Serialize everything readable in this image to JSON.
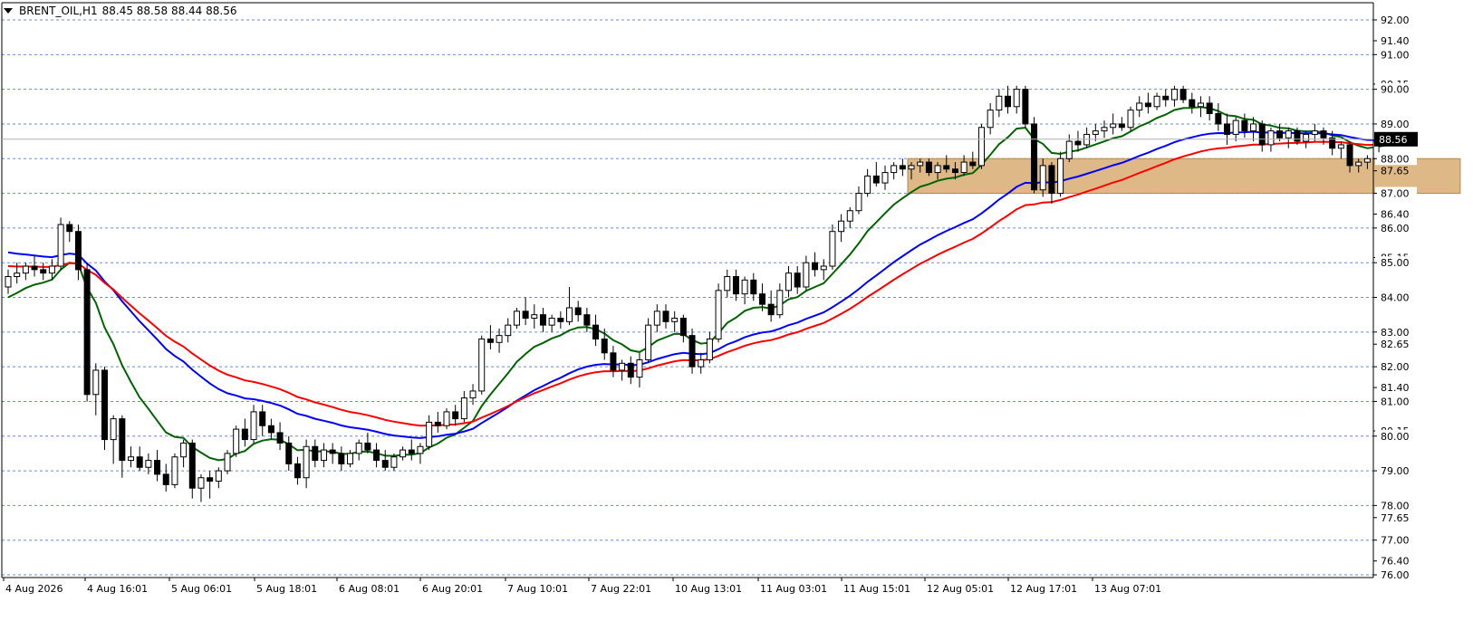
{
  "header": {
    "symbol_timeframe": "BRENT_OIL,H1",
    "ohlc": "88.45 88.58 88.44 88.56"
  },
  "chart_data": {
    "type": "candlestick",
    "ylim": [
      76.0,
      92.1
    ],
    "grid": true,
    "price_grid_levels": [
      92.0,
      91.0,
      90.0,
      89.0,
      88.0,
      87.0,
      86.0,
      85.0,
      84.0,
      83.0,
      82.0,
      81.0,
      80.0,
      79.0,
      78.0,
      77.0,
      76.0
    ],
    "y_tick_labels": [
      "92.00",
      "91.40",
      "91.00",
      "90.15",
      "90.00",
      "89.00",
      "88.00",
      "87.65",
      "87.00",
      "86.40",
      "86.00",
      "85.15",
      "85.00",
      "84.00",
      "83.00",
      "82.65",
      "82.00",
      "81.40",
      "81.00",
      "80.15",
      "80.00",
      "79.00",
      "78.00",
      "77.65",
      "77.00",
      "76.40",
      "76.00"
    ],
    "current_price": 88.56,
    "x_tick_labels": [
      "4 Aug 2026",
      "4 Aug 16:01",
      "5 Aug 06:01",
      "5 Aug 18:01",
      "6 Aug 08:01",
      "6 Aug 20:01",
      "7 Aug 10:01",
      "7 Aug 22:01",
      "10 Aug 13:01",
      "11 Aug 03:01",
      "11 Aug 15:01",
      "12 Aug 05:01",
      "12 Aug 17:01",
      "13 Aug 07:01"
    ],
    "zone": {
      "low": 87.0,
      "high": 88.0,
      "from_bar": 103,
      "to_bar": 166,
      "color": "#deb887"
    },
    "candles": [
      [
        84.3,
        84.8,
        84.1,
        84.6
      ],
      [
        84.6,
        85.0,
        84.4,
        84.7
      ],
      [
        84.7,
        85.0,
        84.5,
        84.9
      ],
      [
        84.9,
        85.2,
        84.6,
        84.8
      ],
      [
        84.8,
        85.0,
        84.5,
        84.7
      ],
      [
        84.7,
        85.1,
        84.5,
        84.9
      ],
      [
        84.9,
        86.3,
        84.8,
        86.1
      ],
      [
        86.1,
        86.2,
        85.6,
        85.9
      ],
      [
        85.9,
        86.1,
        84.5,
        84.8
      ],
      [
        84.8,
        85.0,
        81.0,
        81.2
      ],
      [
        81.2,
        82.1,
        80.6,
        81.9
      ],
      [
        81.9,
        82.0,
        79.6,
        79.9
      ],
      [
        79.9,
        80.6,
        79.2,
        80.5
      ],
      [
        80.5,
        80.6,
        78.8,
        79.3
      ],
      [
        79.3,
        79.7,
        79.1,
        79.4
      ],
      [
        79.4,
        79.7,
        79.0,
        79.1
      ],
      [
        79.1,
        79.5,
        78.9,
        79.3
      ],
      [
        79.3,
        79.6,
        78.7,
        78.9
      ],
      [
        78.9,
        79.2,
        78.4,
        78.6
      ],
      [
        78.6,
        79.5,
        78.5,
        79.4
      ],
      [
        79.4,
        79.9,
        79.1,
        79.8
      ],
      [
        79.8,
        79.9,
        78.2,
        78.5
      ],
      [
        78.5,
        78.9,
        78.1,
        78.8
      ],
      [
        78.8,
        79.0,
        78.2,
        78.7
      ],
      [
        78.7,
        79.1,
        78.5,
        79.0
      ],
      [
        79.0,
        79.6,
        78.9,
        79.5
      ],
      [
        79.5,
        80.3,
        79.4,
        80.2
      ],
      [
        80.2,
        80.5,
        79.7,
        79.9
      ],
      [
        79.9,
        80.9,
        79.8,
        80.7
      ],
      [
        80.7,
        80.9,
        80.0,
        80.3
      ],
      [
        80.3,
        80.5,
        79.9,
        80.1
      ],
      [
        80.1,
        80.4,
        79.6,
        79.8
      ],
      [
        79.8,
        80.0,
        79.0,
        79.2
      ],
      [
        79.2,
        79.4,
        78.6,
        78.8
      ],
      [
        78.8,
        79.9,
        78.5,
        79.7
      ],
      [
        79.7,
        79.9,
        79.1,
        79.3
      ],
      [
        79.3,
        79.8,
        79.1,
        79.6
      ],
      [
        79.6,
        79.8,
        79.2,
        79.5
      ],
      [
        79.5,
        79.7,
        79.0,
        79.2
      ],
      [
        79.2,
        79.6,
        79.1,
        79.5
      ],
      [
        79.5,
        79.9,
        79.3,
        79.8
      ],
      [
        79.8,
        80.1,
        79.5,
        79.6
      ],
      [
        79.6,
        79.8,
        79.1,
        79.3
      ],
      [
        79.3,
        79.6,
        79.0,
        79.1
      ],
      [
        79.1,
        79.5,
        79.0,
        79.4
      ],
      [
        79.4,
        79.7,
        79.3,
        79.6
      ],
      [
        79.6,
        79.9,
        79.3,
        79.5
      ],
      [
        79.5,
        79.8,
        79.2,
        79.7
      ],
      [
        79.7,
        80.6,
        79.6,
        80.4
      ],
      [
        80.4,
        80.7,
        80.1,
        80.3
      ],
      [
        80.3,
        80.8,
        80.2,
        80.7
      ],
      [
        80.7,
        80.9,
        80.3,
        80.5
      ],
      [
        80.5,
        81.3,
        80.4,
        81.1
      ],
      [
        81.1,
        81.5,
        80.9,
        81.3
      ],
      [
        81.3,
        82.9,
        81.2,
        82.8
      ],
      [
        82.8,
        83.2,
        82.5,
        82.7
      ],
      [
        82.7,
        83.1,
        82.4,
        82.9
      ],
      [
        82.9,
        83.4,
        82.7,
        83.2
      ],
      [
        83.2,
        83.7,
        83.1,
        83.6
      ],
      [
        83.6,
        84.0,
        83.2,
        83.4
      ],
      [
        83.4,
        83.8,
        83.1,
        83.5
      ],
      [
        83.5,
        83.7,
        83.0,
        83.2
      ],
      [
        83.2,
        83.5,
        83.0,
        83.4
      ],
      [
        83.4,
        83.6,
        83.1,
        83.3
      ],
      [
        83.3,
        84.3,
        83.2,
        83.7
      ],
      [
        83.7,
        83.9,
        83.3,
        83.5
      ],
      [
        83.5,
        83.7,
        83.0,
        83.2
      ],
      [
        83.2,
        83.5,
        82.6,
        82.8
      ],
      [
        82.8,
        83.1,
        82.2,
        82.4
      ],
      [
        82.4,
        82.6,
        81.7,
        81.9
      ],
      [
        81.9,
        82.2,
        81.6,
        82.1
      ],
      [
        82.1,
        82.3,
        81.5,
        81.7
      ],
      [
        81.7,
        82.4,
        81.4,
        82.2
      ],
      [
        82.2,
        83.4,
        82.1,
        83.2
      ],
      [
        83.2,
        83.8,
        83.0,
        83.6
      ],
      [
        83.6,
        83.8,
        83.1,
        83.3
      ],
      [
        83.3,
        83.6,
        83.0,
        83.4
      ],
      [
        83.4,
        83.5,
        82.7,
        82.9
      ],
      [
        82.9,
        83.1,
        81.8,
        82.0
      ],
      [
        82.0,
        82.4,
        81.8,
        82.2
      ],
      [
        82.2,
        83.0,
        82.1,
        82.8
      ],
      [
        82.8,
        84.4,
        82.7,
        84.2
      ],
      [
        84.2,
        84.8,
        84.0,
        84.6
      ],
      [
        84.6,
        84.8,
        83.9,
        84.1
      ],
      [
        84.1,
        84.6,
        83.8,
        84.5
      ],
      [
        84.5,
        84.7,
        83.9,
        84.1
      ],
      [
        84.1,
        84.4,
        83.6,
        83.8
      ],
      [
        83.8,
        84.2,
        83.3,
        83.5
      ],
      [
        83.5,
        84.4,
        83.4,
        84.2
      ],
      [
        84.2,
        84.9,
        84.0,
        84.7
      ],
      [
        84.7,
        84.9,
        84.1,
        84.3
      ],
      [
        84.3,
        85.2,
        84.2,
        85.0
      ],
      [
        85.0,
        85.3,
        84.6,
        84.8
      ],
      [
        84.8,
        85.1,
        84.5,
        84.9
      ],
      [
        84.9,
        86.1,
        84.8,
        85.9
      ],
      [
        85.9,
        86.4,
        85.6,
        86.2
      ],
      [
        86.2,
        86.6,
        86.0,
        86.5
      ],
      [
        86.5,
        87.2,
        86.4,
        87.0
      ],
      [
        87.0,
        87.7,
        86.9,
        87.5
      ],
      [
        87.5,
        87.9,
        87.2,
        87.3
      ],
      [
        87.3,
        87.8,
        87.1,
        87.6
      ],
      [
        87.6,
        87.9,
        87.4,
        87.8
      ],
      [
        87.8,
        88.0,
        87.5,
        87.7
      ],
      [
        87.7,
        87.9,
        87.4,
        87.8
      ],
      [
        87.8,
        88.0,
        87.6,
        87.9
      ],
      [
        87.9,
        88.0,
        87.5,
        87.6
      ],
      [
        87.6,
        87.9,
        87.4,
        87.8
      ],
      [
        87.8,
        88.1,
        87.6,
        87.7
      ],
      [
        87.7,
        87.9,
        87.4,
        87.6
      ],
      [
        87.6,
        88.1,
        87.5,
        87.9
      ],
      [
        87.9,
        88.2,
        87.7,
        87.8
      ],
      [
        87.8,
        89.0,
        87.7,
        88.9
      ],
      [
        88.9,
        89.6,
        88.7,
        89.4
      ],
      [
        89.4,
        90.0,
        89.2,
        89.8
      ],
      [
        89.8,
        90.1,
        89.3,
        89.5
      ],
      [
        89.5,
        90.1,
        89.3,
        90.0
      ],
      [
        90.0,
        90.1,
        88.9,
        89.0
      ],
      [
        89.0,
        89.2,
        87.0,
        87.1
      ],
      [
        87.1,
        88.0,
        86.9,
        87.8
      ],
      [
        87.8,
        87.9,
        86.7,
        87.0
      ],
      [
        87.0,
        88.2,
        86.9,
        88.0
      ],
      [
        88.0,
        88.7,
        87.9,
        88.5
      ],
      [
        88.5,
        88.8,
        88.2,
        88.4
      ],
      [
        88.4,
        88.9,
        88.3,
        88.7
      ],
      [
        88.7,
        89.0,
        88.5,
        88.8
      ],
      [
        88.8,
        89.1,
        88.6,
        88.9
      ],
      [
        88.9,
        89.3,
        88.7,
        89.0
      ],
      [
        89.0,
        89.2,
        88.8,
        88.9
      ],
      [
        88.9,
        89.5,
        88.8,
        89.4
      ],
      [
        89.4,
        89.8,
        89.2,
        89.6
      ],
      [
        89.6,
        89.9,
        89.3,
        89.5
      ],
      [
        89.5,
        89.9,
        89.4,
        89.8
      ],
      [
        89.8,
        90.0,
        89.5,
        89.7
      ],
      [
        89.7,
        90.1,
        89.5,
        90.0
      ],
      [
        90.0,
        90.1,
        89.6,
        89.7
      ],
      [
        89.7,
        89.9,
        89.3,
        89.5
      ],
      [
        89.5,
        89.8,
        89.2,
        89.6
      ],
      [
        89.6,
        89.8,
        89.1,
        89.3
      ],
      [
        89.3,
        89.6,
        88.8,
        89.0
      ],
      [
        89.0,
        89.3,
        88.4,
        88.7
      ],
      [
        88.7,
        89.2,
        88.5,
        89.1
      ],
      [
        89.1,
        89.3,
        88.6,
        88.8
      ],
      [
        88.8,
        89.2,
        88.5,
        89.0
      ],
      [
        89.0,
        89.1,
        88.2,
        88.4
      ],
      [
        88.4,
        88.9,
        88.2,
        88.8
      ],
      [
        88.8,
        89.0,
        88.5,
        88.6
      ],
      [
        88.6,
        88.9,
        88.3,
        88.8
      ],
      [
        88.8,
        88.9,
        88.4,
        88.5
      ],
      [
        88.5,
        88.8,
        88.3,
        88.7
      ],
      [
        88.7,
        89.0,
        88.5,
        88.8
      ],
      [
        88.8,
        88.9,
        88.4,
        88.6
      ],
      [
        88.6,
        88.8,
        88.1,
        88.3
      ],
      [
        88.3,
        88.5,
        88.0,
        88.4
      ],
      [
        88.4,
        88.5,
        87.6,
        87.8
      ],
      [
        87.8,
        88.0,
        87.6,
        87.9
      ],
      [
        87.9,
        88.1,
        87.7,
        88.0
      ],
      [
        88.0,
        88.6,
        87.9,
        88.5
      ],
      [
        88.5,
        88.6,
        88.4,
        88.56
      ]
    ],
    "moving_averages": [
      {
        "color": "#006400",
        "period": 10
      },
      {
        "color": "#0000ff",
        "period": 30
      },
      {
        "color": "#ff0000",
        "period": 40
      }
    ]
  }
}
